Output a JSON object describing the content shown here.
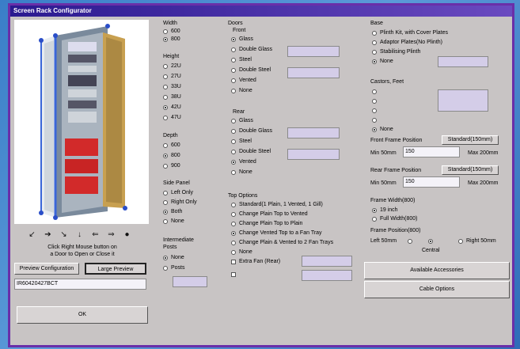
{
  "window": {
    "title": "Screen Rack Configurator"
  },
  "left": {
    "nav_icons": [
      "↙",
      "➔",
      "↘",
      "↓",
      "⇐",
      "⇒",
      "●"
    ],
    "hint_line1": "Click Right Mouse button on",
    "hint_line2": "a Door to Open or Close it",
    "preview_config_label": "Preview Configuration",
    "large_preview_label": "Large Preview",
    "code_value": "IR60420427BCT",
    "ok_label": "OK"
  },
  "width": {
    "title": "Width",
    "options": [
      "600",
      "800"
    ],
    "selected": 1
  },
  "height": {
    "title": "Height",
    "options": [
      "22U",
      "27U",
      "33U",
      "38U",
      "42U",
      "47U"
    ],
    "selected": 4
  },
  "depth": {
    "title": "Depth",
    "options": [
      "600",
      "800",
      "900"
    ],
    "selected": 1
  },
  "side_panel": {
    "title": "Side Panel",
    "options": [
      "Left Only",
      "Right Only",
      "Both",
      "None"
    ],
    "selected": 2
  },
  "intermediate": {
    "title1": "Intermediate",
    "title2": "Posts",
    "options": [
      "None",
      "Posts"
    ],
    "selected": 0
  },
  "doors": {
    "title": "Doors",
    "front_title": "Front",
    "front_options": [
      "Glass",
      "Double Glass",
      "Steel",
      "Double Steel",
      "Vented",
      "None"
    ],
    "front_selected": 0,
    "rear_title": "Rear",
    "rear_options": [
      "Glass",
      "Double Glass",
      "Steel",
      "Double Steel",
      "Vented",
      "None"
    ],
    "rear_selected": 4
  },
  "top_options": {
    "title": "Top Options",
    "options": [
      "Standard(1 Plain, 1 Vented, 1 Gill)",
      "Change Plain Top to Vented",
      "Change Plain Top to Plain",
      "Change Vented Top to a Fan Tray",
      "Change Plain & Vented to 2 Fan Trays",
      "None"
    ],
    "selected": 3,
    "extra_fan_label": "Extra Fan (Rear)"
  },
  "base": {
    "title": "Base",
    "options": [
      "Plinth Kit, with Cover Plates",
      "Adaptor Plates(No Plinth)",
      "Stabilising Plinth",
      "None"
    ],
    "selected": 3
  },
  "castors": {
    "title": "Castors, Feet",
    "options": [
      "",
      "",
      "",
      ""
    ],
    "none_label": "None",
    "selected": 4
  },
  "front_frame": {
    "title": "Front Frame Position",
    "standard_label": "Standard(150mm)",
    "min_label": "Min 50mm",
    "value": "150",
    "max_label": "Max 200mm"
  },
  "rear_frame": {
    "title": "Rear Frame Position",
    "standard_label": "Standard(150mm)",
    "min_label": "Min 50mm",
    "value": "150",
    "max_label": "Max 200mm"
  },
  "frame_width": {
    "title": "Frame Width(800)",
    "options": [
      "19 inch",
      "Full Width(800)"
    ],
    "selected": 0
  },
  "frame_position": {
    "title": "Frame Position(800)",
    "left_label": "Left 50mm",
    "center_label": "Central",
    "right_label": "Right 50mm",
    "selected": 1
  },
  "buttons": {
    "accessories": "Available Accessories",
    "cable": "Cable Options"
  }
}
